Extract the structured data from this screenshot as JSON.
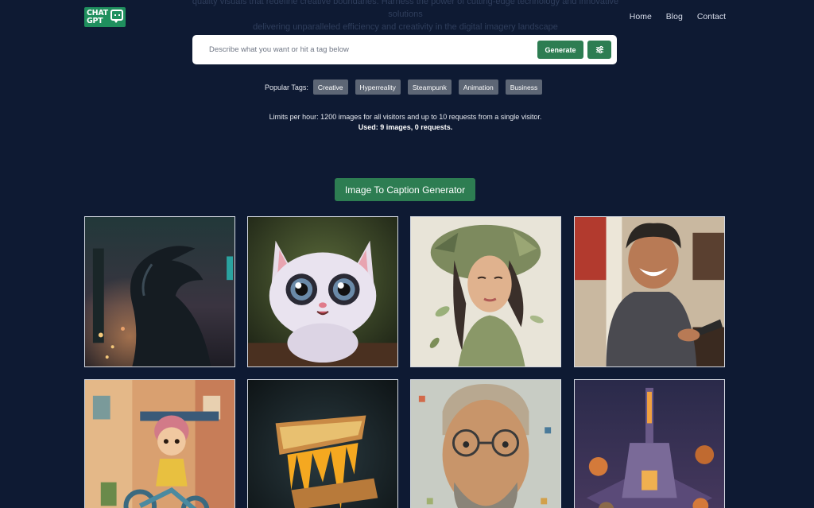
{
  "intro": {
    "line1": "quality visuals that redefine creative boundaries. Harness the power of cutting-edge technology and innovative solutions",
    "line2": "delivering unparalleled efficiency and creativity in the digital imagery landscape"
  },
  "header": {
    "logo_line1": "CHAT",
    "logo_line2": "GPT",
    "nav": [
      {
        "label": "Home"
      },
      {
        "label": "Blog"
      },
      {
        "label": "Contact"
      }
    ]
  },
  "search": {
    "placeholder": "Describe what you want or hit a tag below",
    "value": "",
    "generate_label": "Generate",
    "filter_icon": "sliders-icon"
  },
  "tags": {
    "label": "Popular Tags:",
    "items": [
      "Creative",
      "Hyperreality",
      "Steampunk",
      "Animation",
      "Business"
    ]
  },
  "limits": {
    "text": "Limits per hour: 1200 images for all visitors and up to 10 requests from a single visitor.",
    "used": "Used: 9 images, 0 requests."
  },
  "caption_button": "Image To Caption Generator",
  "gallery": [
    {
      "subject": "dark alien creature in neon city"
    },
    {
      "subject": "cute cartoon kitten"
    },
    {
      "subject": "woman with leaves portrait"
    },
    {
      "subject": "laughing man with phone in kitchen"
    },
    {
      "subject": "cartoon girl on tricycle"
    },
    {
      "subject": "grilled cheese sandwich"
    },
    {
      "subject": "mosaic portrait of man with glasses"
    },
    {
      "subject": "isometric tower at night"
    }
  ],
  "colors": {
    "background": "#0e1a33",
    "accent": "#2d7d52",
    "tag": "#5d6675"
  }
}
